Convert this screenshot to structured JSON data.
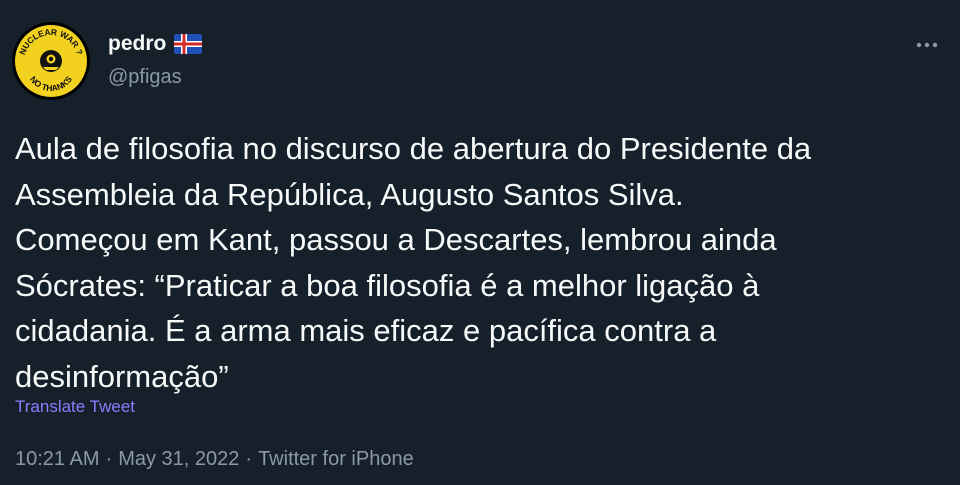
{
  "author": {
    "display_name": "pedro",
    "handle": "@pfigas",
    "flag_icon": "iceland-flag-icon",
    "avatar_text_top": "NUCLEAR WAR ?",
    "avatar_text_bottom": "NO THANKS"
  },
  "more_icon": "more-horizontal-icon",
  "tweet": {
    "text": "Aula de filosofia no discurso de abertura do Presidente da\nAssembleia da República, Augusto Santos Silva.\nComeçou em Kant, passou a Descartes, lembrou ainda\nSócrates: “Praticar a boa filosofia é a melhor ligação à\ncidadania. É a arma mais eficaz e pacífica contra a\ndesinformação”",
    "translate_label": "Translate Tweet"
  },
  "meta": {
    "time": "10:21 AM",
    "sep1": "·",
    "date": "May 31, 2022",
    "sep2": "·",
    "source": "Twitter for iPhone"
  },
  "colors": {
    "background": "#15202b",
    "text": "#f7f9f9",
    "secondary": "#8b98a5",
    "link": "#8c7bff",
    "avatar_badge": "#f2d21f"
  }
}
